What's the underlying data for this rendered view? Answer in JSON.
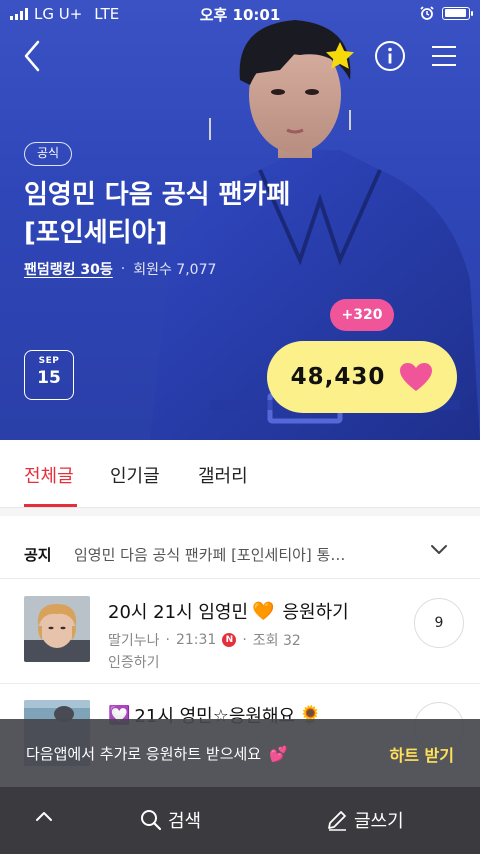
{
  "status_bar": {
    "carrier": "LG U+",
    "network": "LTE",
    "time": "오후 10:01",
    "battery_level": 0.95
  },
  "header": {
    "back_icon": "chevron-left-icon",
    "favorite_icon": "star-icon",
    "favorite_color": "#f5d90a",
    "info_icon": "info-icon",
    "menu_icon": "hamburger-icon"
  },
  "cafe": {
    "badge": "공식",
    "title": "임영민 다음 공식 팬카페 [포인세티아]",
    "rank_link": "팬덤랭킹 30등",
    "separator": "·",
    "members": "회원수 7,077"
  },
  "date": {
    "month": "SEP",
    "day": "15"
  },
  "hearts": {
    "increment": "+320",
    "count": "48,430",
    "heart_color": "#f0559a",
    "button_color": "#fbf08a"
  },
  "tabs": [
    {
      "label": "전체글",
      "active": true
    },
    {
      "label": "인기글",
      "active": false
    },
    {
      "label": "갤러리",
      "active": false
    }
  ],
  "notice": {
    "label": "공지",
    "text": "임영민 다음 공식 팬카페 [포인세티아] 통…"
  },
  "posts": [
    {
      "title": "20시 21시 임영민",
      "title_emoji": "🧡",
      "title_suffix": "응원하기",
      "author": "딸기누나",
      "time": "21:31",
      "new_badge": "N",
      "views": "조회 32",
      "tag": "인증하기",
      "comments": "9"
    },
    {
      "title_prefix_emoji": "💟",
      "title": "21시 영민☆응원해요",
      "title_emoji": "🌻"
    }
  ],
  "toast": {
    "message": "다음앱에서 추가로 응원하트 받으세요",
    "emoji": "💕",
    "action": "하트 받기"
  },
  "bottom_bar": {
    "up_icon": "chevron-up-icon",
    "search_label": "검색",
    "write_label": "글쓰기"
  },
  "colors": {
    "accent": "#e4303b",
    "hero_blue": "#2f46b8"
  }
}
